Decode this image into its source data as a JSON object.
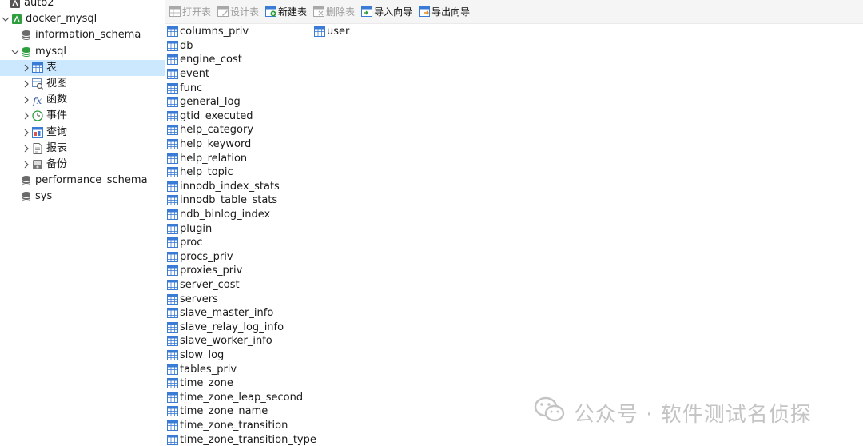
{
  "sidebar": {
    "items": [
      {
        "label": "auto2",
        "level": 0,
        "icon": "connection-icon",
        "expanded": null
      },
      {
        "label": "docker_mysql",
        "level": 0,
        "icon": "connection-active-icon",
        "expanded": true
      },
      {
        "label": "information_schema",
        "level": 1,
        "icon": "database-icon",
        "expanded": null
      },
      {
        "label": "mysql",
        "level": 1,
        "icon": "database-active-icon",
        "expanded": true
      },
      {
        "label": "表",
        "level": 2,
        "icon": "table-folder-icon",
        "expanded": false,
        "selected": true
      },
      {
        "label": "视图",
        "level": 2,
        "icon": "view-folder-icon",
        "expanded": false
      },
      {
        "label": "函数",
        "level": 2,
        "icon": "function-folder-icon",
        "expanded": false
      },
      {
        "label": "事件",
        "level": 2,
        "icon": "event-folder-icon",
        "expanded": false
      },
      {
        "label": "查询",
        "level": 2,
        "icon": "query-folder-icon",
        "expanded": false
      },
      {
        "label": "报表",
        "level": 2,
        "icon": "report-folder-icon",
        "expanded": false
      },
      {
        "label": "备份",
        "level": 2,
        "icon": "backup-folder-icon",
        "expanded": false
      },
      {
        "label": "performance_schema",
        "level": 1,
        "icon": "database-icon",
        "expanded": null
      },
      {
        "label": "sys",
        "level": 1,
        "icon": "database-icon",
        "expanded": null
      }
    ]
  },
  "toolbar": {
    "buttons": [
      {
        "label": "打开表",
        "icon": "open-table-icon",
        "enabled": false
      },
      {
        "label": "设计表",
        "icon": "design-table-icon",
        "enabled": false
      },
      {
        "label": "新建表",
        "icon": "new-table-icon",
        "enabled": true
      },
      {
        "label": "删除表",
        "icon": "delete-table-icon",
        "enabled": false
      },
      {
        "label": "导入向导",
        "icon": "import-wizard-icon",
        "enabled": true
      },
      {
        "label": "导出向导",
        "icon": "export-wizard-icon",
        "enabled": true
      }
    ]
  },
  "tables": {
    "column1": [
      "columns_priv",
      "db",
      "engine_cost",
      "event",
      "func",
      "general_log",
      "gtid_executed",
      "help_category",
      "help_keyword",
      "help_relation",
      "help_topic",
      "innodb_index_stats",
      "innodb_table_stats",
      "ndb_binlog_index",
      "plugin",
      "proc",
      "procs_priv",
      "proxies_priv",
      "server_cost",
      "servers",
      "slave_master_info",
      "slave_relay_log_info",
      "slave_worker_info",
      "slow_log",
      "tables_priv",
      "time_zone",
      "time_zone_leap_second",
      "time_zone_name",
      "time_zone_transition",
      "time_zone_transition_type"
    ],
    "column2": [
      "user"
    ]
  },
  "watermark": {
    "text": "公众号 · 软件测试名侦探",
    "icon": "wechat-icon"
  },
  "colors": {
    "selection": "#cce8ff",
    "connection_green": "#2e9e3e",
    "toolbar_bg": "#f5f5f5",
    "table_icon_blue": "#3a7bd5"
  }
}
